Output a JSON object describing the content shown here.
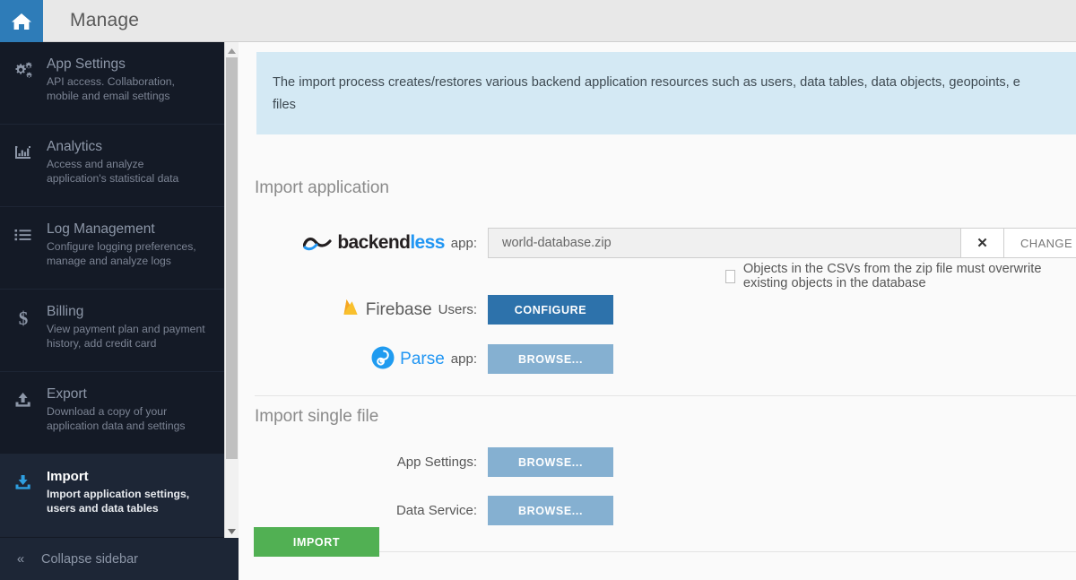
{
  "topbar": {
    "home_icon": "home-icon",
    "title": "Manage"
  },
  "sidebar": {
    "items": [
      {
        "icon": "gears-icon",
        "title": "App Settings",
        "desc": "API access. Collaboration, mobile and email settings",
        "active": false
      },
      {
        "icon": "bar-chart-icon",
        "title": "Analytics",
        "desc": "Access and analyze application's statistical data",
        "active": false
      },
      {
        "icon": "list-icon",
        "title": "Log Management",
        "desc": "Configure logging preferences, manage and analyze logs",
        "active": false
      },
      {
        "icon": "dollar-icon",
        "title": "Billing",
        "desc": "View payment plan and payment history, add credit card",
        "active": false
      },
      {
        "icon": "upload-icon",
        "title": "Export",
        "desc": "Download a copy of your application data and settings",
        "active": false
      },
      {
        "icon": "download-icon",
        "title": "Import",
        "desc": "Import application settings, users and data tables",
        "active": true
      }
    ],
    "collapse_label": "Collapse sidebar",
    "collapse_icon": "chevron-double-left-icon",
    "scrollbar": {
      "up_icon": "triangle-up-icon",
      "down_icon": "triangle-down-icon"
    }
  },
  "main": {
    "info_banner": {
      "line1": "The import process creates/restores various backend application resources such as users, data tables, data objects, geopoints, e",
      "line2": "files"
    },
    "import_application": {
      "title": "Import application",
      "backendless_row": {
        "logo_word_dark": "backend",
        "logo_word_blue": "less",
        "label": "app:",
        "file_value": "world-database.zip",
        "clear_icon": "close-icon",
        "change_label": "CHANGE"
      },
      "overwrite_checkbox": {
        "label": "Objects in the CSVs from the zip file must overwrite existing objects in the database",
        "checked": false
      },
      "firebase_row": {
        "logo_icon": "firebase-flame-icon",
        "logo_word": "Firebase",
        "label": "Users:",
        "button_label": "CONFIGURE"
      },
      "parse_row": {
        "logo_icon": "parse-circle-icon",
        "logo_word": "Parse",
        "label": "app:",
        "button_label": "BROWSE..."
      }
    },
    "import_single_file": {
      "title": "Import single file",
      "rows": [
        {
          "label": "App Settings:",
          "button_label": "BROWSE..."
        },
        {
          "label": "Data Service:",
          "button_label": "BROWSE..."
        }
      ]
    },
    "import_button_label": "IMPORT"
  },
  "colors": {
    "accent_blue": "#2e7cb8",
    "sidebar_bg": "#141a26",
    "banner_bg": "#d4e9f4",
    "primary_button": "#2d72ab",
    "secondary_button": "#85b0d1",
    "import_button": "#51b053"
  }
}
